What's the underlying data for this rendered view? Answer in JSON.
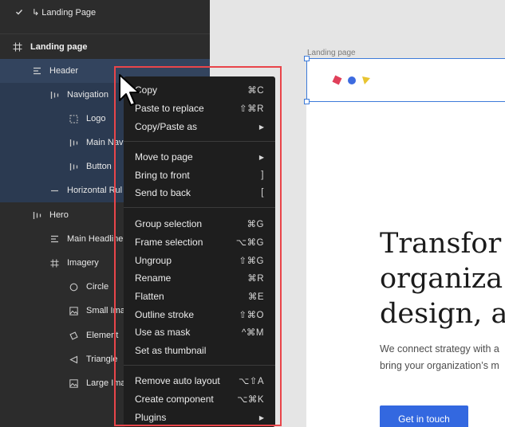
{
  "layers": {
    "items": [
      {
        "label": "↳ Landing Page",
        "icon": "check-icon"
      },
      {
        "label": "Landing page",
        "icon": "frame-icon"
      },
      {
        "label": "Header",
        "icon": "text-align-icon"
      },
      {
        "label": "Navigation",
        "icon": "auto-layout-icon"
      },
      {
        "label": "Logo",
        "icon": "dashed-frame-icon"
      },
      {
        "label": "Main Navi",
        "icon": "auto-layout-icon"
      },
      {
        "label": "Button",
        "icon": "auto-layout-icon"
      },
      {
        "label": "Horizontal Rul",
        "icon": "line-icon"
      },
      {
        "label": "Hero",
        "icon": "auto-layout-icon"
      },
      {
        "label": "Main Headline",
        "icon": "text-align-icon"
      },
      {
        "label": "Imagery",
        "icon": "frame-icon"
      },
      {
        "label": "Circle",
        "icon": "circle-icon"
      },
      {
        "label": "Small Ima",
        "icon": "image-icon"
      },
      {
        "label": "Element",
        "icon": "polygon-icon"
      },
      {
        "label": "Triangle",
        "icon": "triangle-icon"
      },
      {
        "label": "Large Ima",
        "icon": "image-icon"
      }
    ]
  },
  "canvas": {
    "frame_label": "Landing page",
    "hero_title_lines": [
      "Transfor",
      "organiza",
      "design, a"
    ],
    "hero_sub_lines": [
      "We connect strategy with a",
      "bring your organization’s m"
    ],
    "cta_label": "Get in touch",
    "logo_colors": [
      "#e0405a",
      "#3d6be0",
      "#e8c431"
    ]
  },
  "context_menu": {
    "items": [
      {
        "label": "Copy",
        "shortcut": "⌘C"
      },
      {
        "label": "Paste to replace",
        "shortcut": "⇧⌘R"
      },
      {
        "label": "Copy/Paste as",
        "submenu": "▶"
      },
      {
        "label": "Move to page",
        "submenu": "▶"
      },
      {
        "label": "Bring to front",
        "shortcut": "]"
      },
      {
        "label": "Send to back",
        "shortcut": "["
      },
      {
        "label": "Group selection",
        "shortcut": "⌘G"
      },
      {
        "label": "Frame selection",
        "shortcut": "⌥⌘G"
      },
      {
        "label": "Ungroup",
        "shortcut": "⇧⌘G"
      },
      {
        "label": "Rename",
        "shortcut": "⌘R"
      },
      {
        "label": "Flatten",
        "shortcut": "⌘E"
      },
      {
        "label": "Outline stroke",
        "shortcut": "⇧⌘O"
      },
      {
        "label": "Use as mask",
        "shortcut": "^⌘M"
      },
      {
        "label": "Set as thumbnail",
        "shortcut": ""
      },
      {
        "label": "Remove auto layout",
        "shortcut": "⌥⇧A"
      },
      {
        "label": "Create component",
        "shortcut": "⌥⌘K"
      },
      {
        "label": "Plugins",
        "submenu": "▶"
      }
    ]
  },
  "colors": {
    "selection": "#33445e",
    "highlight_outline": "#e9454a",
    "accent": "#3368e0"
  }
}
